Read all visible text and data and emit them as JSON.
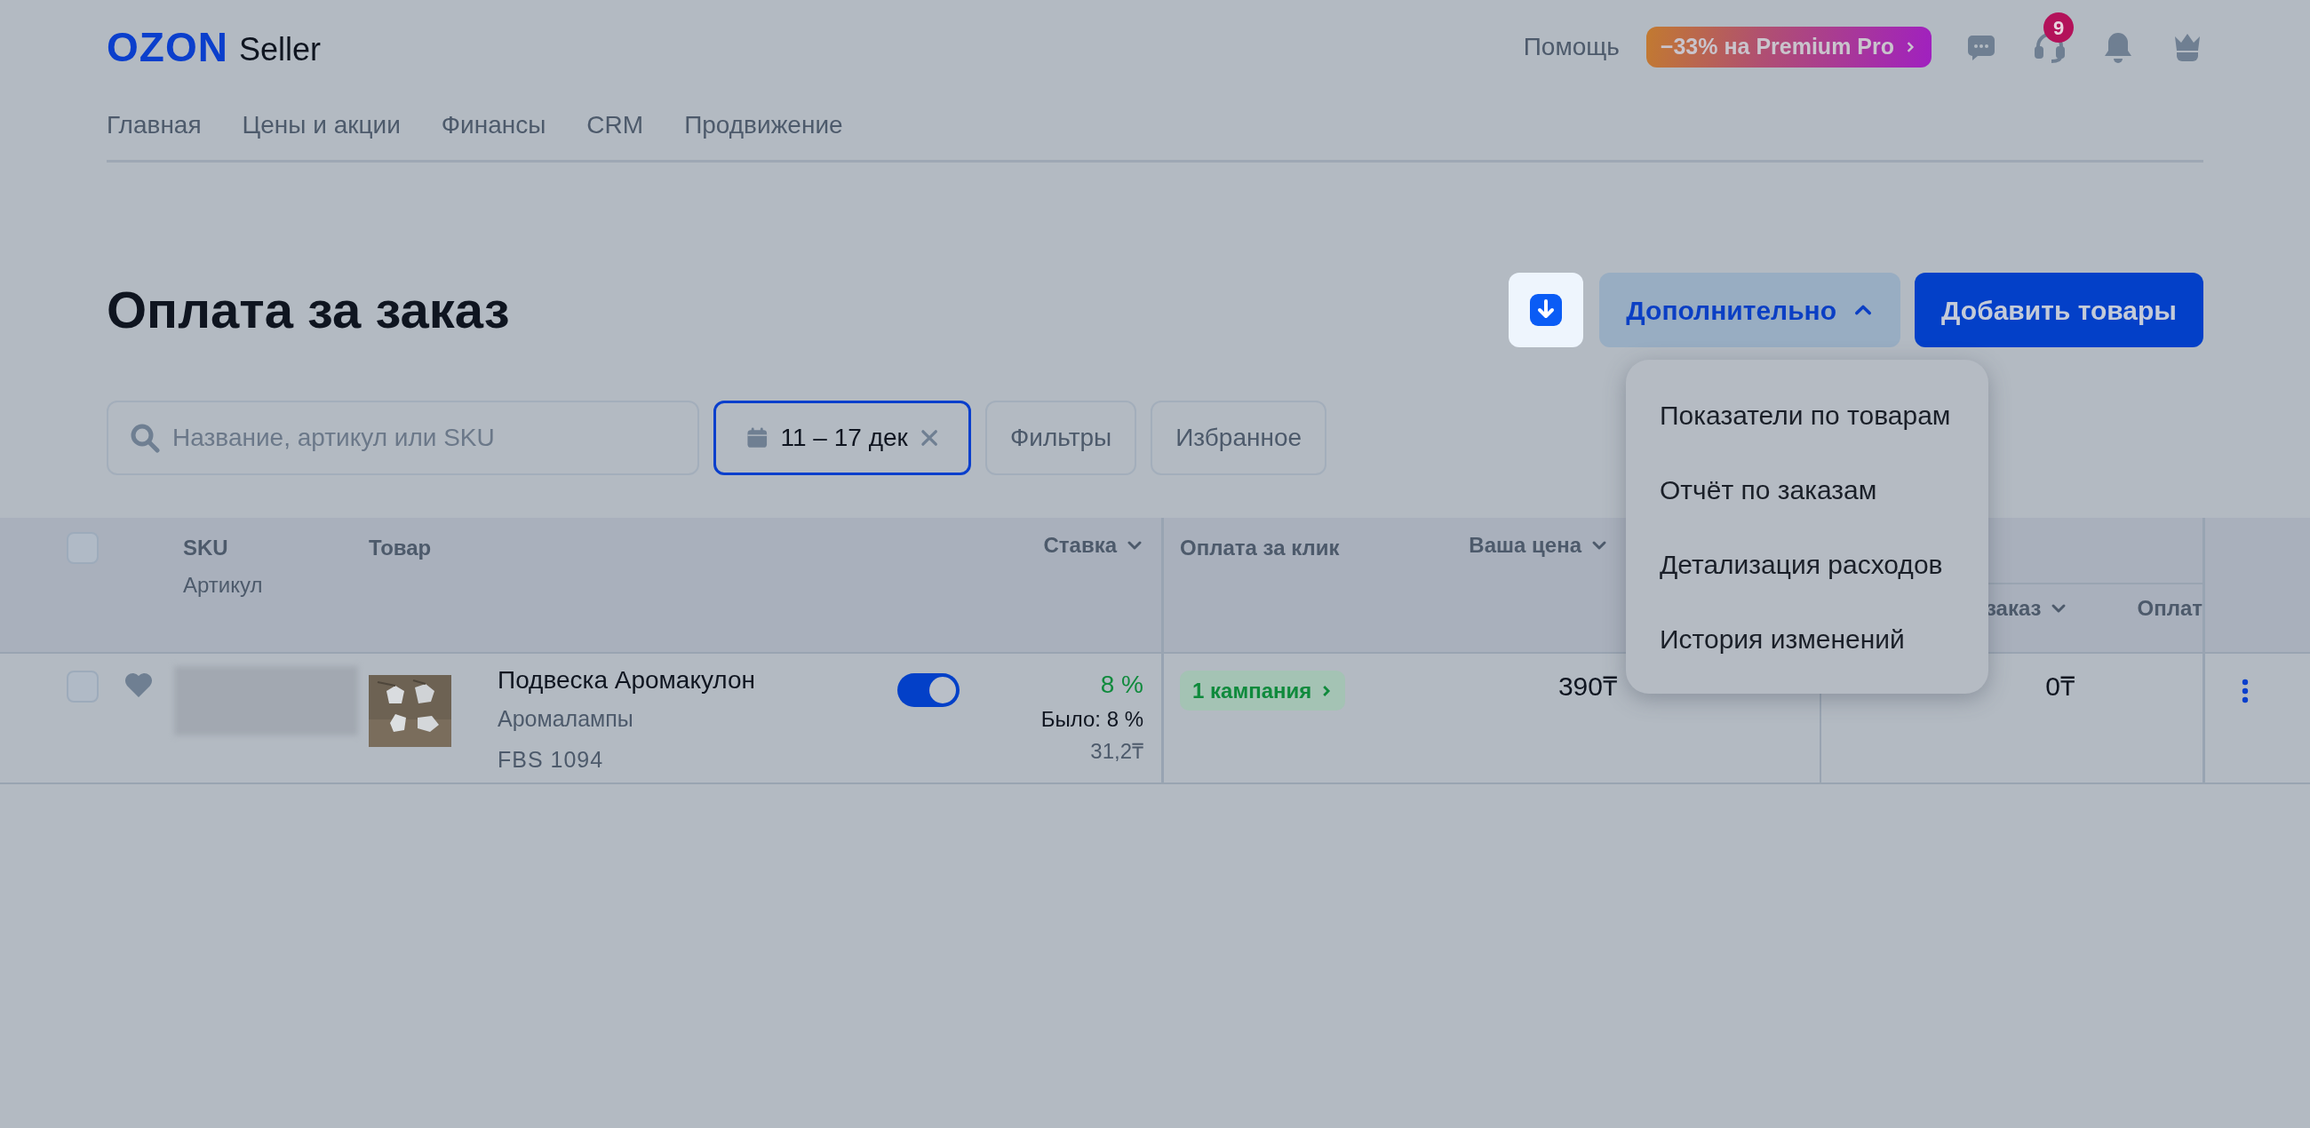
{
  "header": {
    "logo": "OZON",
    "logo_suffix": "Seller",
    "help": "Помощь",
    "promo": "−33% на Premium Pro",
    "support_badge": "9"
  },
  "nav": [
    {
      "label": "Главная"
    },
    {
      "label": "Цены и акции"
    },
    {
      "label": "Финансы"
    },
    {
      "label": "CRM"
    },
    {
      "label": "Продвижение"
    }
  ],
  "title": "Оплата за заказ",
  "actions": {
    "more": {
      "label": "Дополнительно",
      "expanded": true
    },
    "add": "Добавить товары"
  },
  "menu": [
    {
      "label": "Показатели по товарам"
    },
    {
      "label": "Отчёт по заказам"
    },
    {
      "label": "Детализация расходов"
    },
    {
      "label": "История изменений"
    }
  ],
  "search": {
    "placeholder": "Название, артикул или SKU"
  },
  "date_filter": {
    "label": "11 – 17 дек"
  },
  "filter_buttons": [
    "Фильтры",
    "Избранное"
  ],
  "table": {
    "select_all": {
      "checked": false
    },
    "columns": {
      "sku": "SKU",
      "article": "Артикул",
      "product": "Товар",
      "rate": "Ставка",
      "click_pay": "Оплата за клик",
      "price": "Ваша цена",
      "column_7": "заказ",
      "column_8": "Оплат"
    },
    "rows": [
      {
        "checked": false,
        "name": "Подвеска Аромакулон",
        "category": "Аромалампы",
        "scheme": "FBS 1094",
        "enabled": true,
        "rate": "8 %",
        "rate_before": "Было: 8 %",
        "rate_amount": "31,2₸",
        "campaigns": "1 кампания",
        "price": "390₸",
        "column_7": "0₸"
      }
    ]
  }
}
